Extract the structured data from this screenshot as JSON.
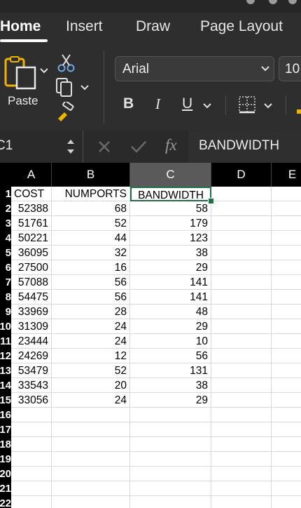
{
  "ribbon": {
    "tabs": [
      {
        "label": "Home",
        "active": true
      },
      {
        "label": "Insert",
        "active": false
      },
      {
        "label": "Draw",
        "active": false
      },
      {
        "label": "Page Layout",
        "active": false
      }
    ],
    "paste_label": "Paste",
    "font_name": "Arial",
    "font_size": "10",
    "bold_label": "B",
    "italic_label": "I",
    "underline_label": "U",
    "accent_color": "#f0b400"
  },
  "formula_bar": {
    "name_box": "C1",
    "fx_label": "fx",
    "content": "BANDWIDTH"
  },
  "sheet": {
    "columns": [
      "A",
      "B",
      "C",
      "D",
      "E"
    ],
    "selected_column": "C",
    "selected_cell": "C1",
    "row_numbers": [
      "1",
      "2",
      "3",
      "4",
      "5",
      "6",
      "7",
      "8",
      "9",
      "10",
      "11",
      "12",
      "13",
      "14",
      "15",
      "16",
      "17",
      "18",
      "19",
      "20",
      "21",
      "22"
    ],
    "headers": [
      "COST",
      "NUMPORTS",
      "BANDWIDTH"
    ],
    "rows": [
      [
        "52388",
        "68",
        "58"
      ],
      [
        "51761",
        "52",
        "179"
      ],
      [
        "50221",
        "44",
        "123"
      ],
      [
        "36095",
        "32",
        "38"
      ],
      [
        "27500",
        "16",
        "29"
      ],
      [
        "57088",
        "56",
        "141"
      ],
      [
        "54475",
        "56",
        "141"
      ],
      [
        "33969",
        "28",
        "48"
      ],
      [
        "31309",
        "24",
        "29"
      ],
      [
        "23444",
        "24",
        "10"
      ],
      [
        "24269",
        "12",
        "56"
      ],
      [
        "53479",
        "52",
        "131"
      ],
      [
        "33543",
        "20",
        "38"
      ],
      [
        "33056",
        "24",
        "29"
      ]
    ],
    "selection_color": "#1e7145"
  }
}
